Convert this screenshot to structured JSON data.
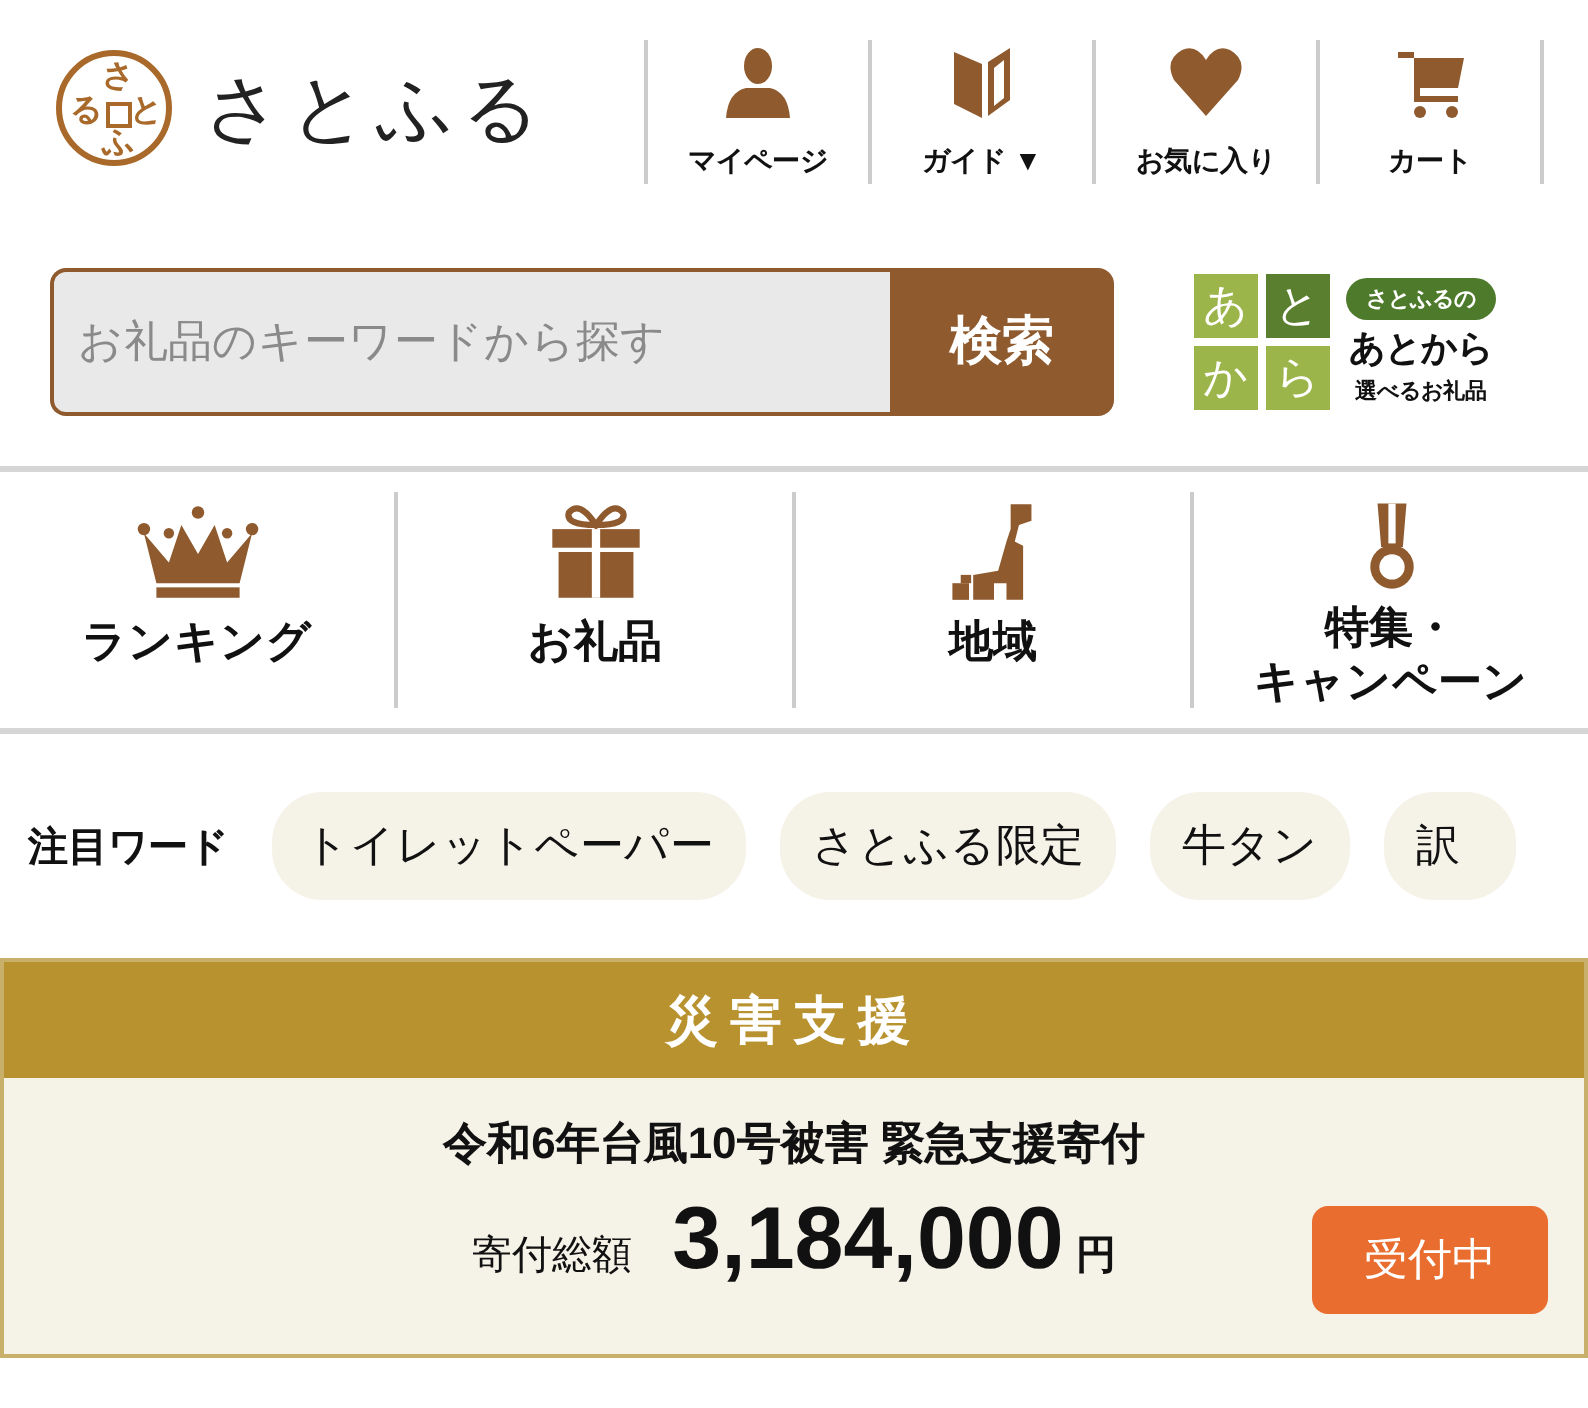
{
  "logo": {
    "stamp_chars": [
      "さ",
      "る",
      "と",
      "ふ"
    ],
    "name": "さとふる"
  },
  "header_nav": [
    {
      "kind": "person",
      "label": "マイページ"
    },
    {
      "kind": "guide",
      "label": "ガイド ▼"
    },
    {
      "kind": "heart",
      "label": "お気に入り"
    },
    {
      "kind": "cart",
      "label": "カート"
    }
  ],
  "search": {
    "placeholder": "お礼品のキーワードから探す",
    "button": "検索"
  },
  "atokara": {
    "tiles": [
      "あ",
      "と",
      "か",
      "ら"
    ],
    "bubble": "さとふるの",
    "title": "あとから",
    "subtitle": "選べるお礼品"
  },
  "categories": [
    {
      "kind": "crown",
      "label_lines": [
        "ランキング"
      ]
    },
    {
      "kind": "gift",
      "label_lines": [
        "お礼品"
      ]
    },
    {
      "kind": "map",
      "label_lines": [
        "地域"
      ]
    },
    {
      "kind": "medal",
      "label_lines": [
        "特集・",
        "キャンペーン"
      ]
    }
  ],
  "keywords": {
    "label": "注目ワード",
    "items": [
      "トイレットペーパー",
      "さとふる限定",
      "牛タン",
      "訳"
    ]
  },
  "disaster": {
    "heading": "災害支援",
    "title": "令和6年台風10号被害 緊急支援寄付",
    "total_label": "寄付総額",
    "amount": "3,184,000",
    "unit": "円",
    "status": "受付中"
  }
}
